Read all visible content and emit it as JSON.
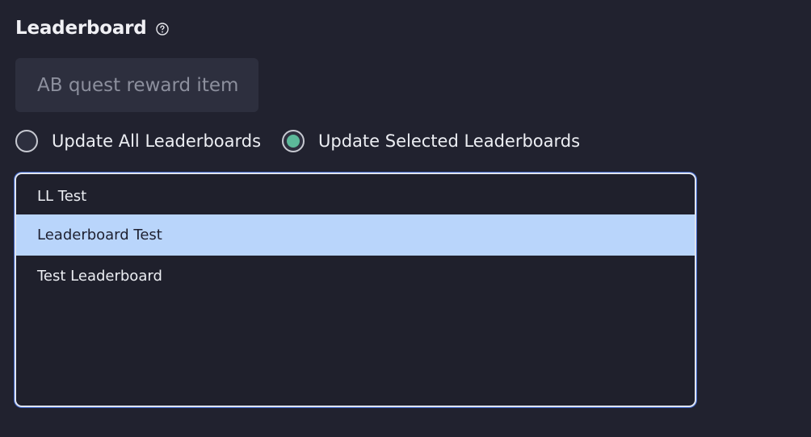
{
  "section": {
    "title": "Leaderboard",
    "help_icon": "question-circle-icon"
  },
  "item_field": {
    "placeholder": "AB quest reward item"
  },
  "update_mode": {
    "options": [
      {
        "label": "Update All Leaderboards",
        "selected": false
      },
      {
        "label": "Update Selected Leaderboards",
        "selected": true
      }
    ]
  },
  "leaderboards": {
    "items": [
      {
        "label": "LL Test",
        "selected": false
      },
      {
        "label": "Leaderboard Test",
        "selected": true
      },
      {
        "label": "Test Leaderboard",
        "selected": false
      }
    ]
  },
  "colors": {
    "background": "#21222f",
    "radio_selected": "#5cb99a",
    "list_selected": "#b9d5fb",
    "focus_ring": "#3c64c8"
  }
}
